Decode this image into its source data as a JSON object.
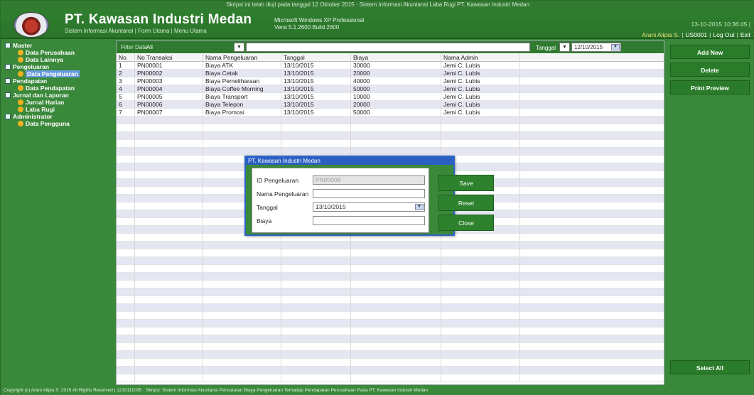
{
  "window": {
    "title": "Skripsi ini telah diuji pada tanggal 12 Oktober 2015 · Sistem Informasi Akuntansi Laba Rugi PT. Kawasan Industri Medan"
  },
  "header": {
    "company_name": "PT. Kawasan Industri Medan",
    "subtitle": "Sistem Informasi Akuntansi | Form Utama | Menu Utama",
    "os_line1": "Microsoft Windows XP Professional",
    "os_line2": "Versi 5.1.2600 Build 2600",
    "datetime": "13-10-2015  10:36:45 |",
    "user_name": "Arani Alipia S.",
    "user_id": "US0001",
    "logout_label": "Log Out",
    "exit_label": "Exit"
  },
  "sidebar": {
    "items": [
      {
        "label": "Master",
        "level": 0
      },
      {
        "label": "Data Perusahaan",
        "level": 1
      },
      {
        "label": "Data Lainnya",
        "level": 1
      },
      {
        "label": "Pengeluaran",
        "level": 0
      },
      {
        "label": "Data Pengeluaran",
        "level": 1,
        "selected": true
      },
      {
        "label": "Pendapatan",
        "level": 0
      },
      {
        "label": "Data Pendapatan",
        "level": 1
      },
      {
        "label": "Jurnal dan Laporan",
        "level": 0
      },
      {
        "label": "Jurnal Harian",
        "level": 1
      },
      {
        "label": "Laba Rugi",
        "level": 1
      },
      {
        "label": "Administrator",
        "level": 0
      },
      {
        "label": "Data Pengguna",
        "level": 1
      }
    ]
  },
  "filter": {
    "label": "Filter Data",
    "value": "All",
    "date_label": "Tanggal",
    "date_value": "12/10/2015"
  },
  "table": {
    "columns": [
      "No",
      "No Transaksi",
      "Nama Pengeluaran",
      "Tanggal",
      "Biaya",
      "Nama Admin",
      ""
    ],
    "rows": [
      [
        "1",
        "PN00001",
        "Biaya ATK",
        "13/10/2015",
        "30000",
        "Jemi C. Lubis",
        ""
      ],
      [
        "2",
        "PN00002",
        "Biaya Cetak",
        "13/10/2015",
        "20000",
        "Jemi C. Lubis",
        ""
      ],
      [
        "3",
        "PN00003",
        "Biaya Pemeliharaan",
        "13/10/2015",
        "40000",
        "Jemi C. Lubis",
        ""
      ],
      [
        "4",
        "PN00004",
        "Biaya Coffee Morning",
        "13/10/2015",
        "50000",
        "Jemi C. Lubis",
        ""
      ],
      [
        "5",
        "PN00005",
        "Biaya Transport",
        "13/10/2015",
        "10000",
        "Jemi C. Lubis",
        ""
      ],
      [
        "6",
        "PN00006",
        "Biaya Telepon",
        "13/10/2015",
        "20000",
        "Jemi C. Lubis",
        ""
      ],
      [
        "7",
        "PN00007",
        "Biaya Promosi",
        "13/10/2015",
        "50000",
        "Jemi C. Lubis",
        ""
      ]
    ]
  },
  "actions": {
    "add_label": "Add New",
    "delete_label": "Delete",
    "print_label": "Print Preview",
    "select_all_label": "Select All"
  },
  "dialog": {
    "title": "PT. Kawasan Industri Medan",
    "id_label": "ID Pengeluaran",
    "id_value": "PN00008",
    "name_label": "Nama Pengeluaran",
    "name_value": "",
    "date_label": "Tanggal",
    "date_value": "13/10/2015",
    "cost_label": "Biaya",
    "cost_value": "",
    "save_label": "Save",
    "reset_label": "Reset",
    "close_label": "Close"
  },
  "statusbar": {
    "text": "Copyright (c) Arani Alipia S. 2015 All Rights Reserved | 1210111035 · Skripsi: Sistem Informasi Akuntansi Pencatatan Biaya Pengeluaran Terhadap Pendapatan Perusahaan Pada PT. Kawasan Industri Medan"
  },
  "icons": {
    "tree_parent": "folder-icon",
    "tree_child": "bullet-icon",
    "dropdown": "chevron-down-icon"
  }
}
